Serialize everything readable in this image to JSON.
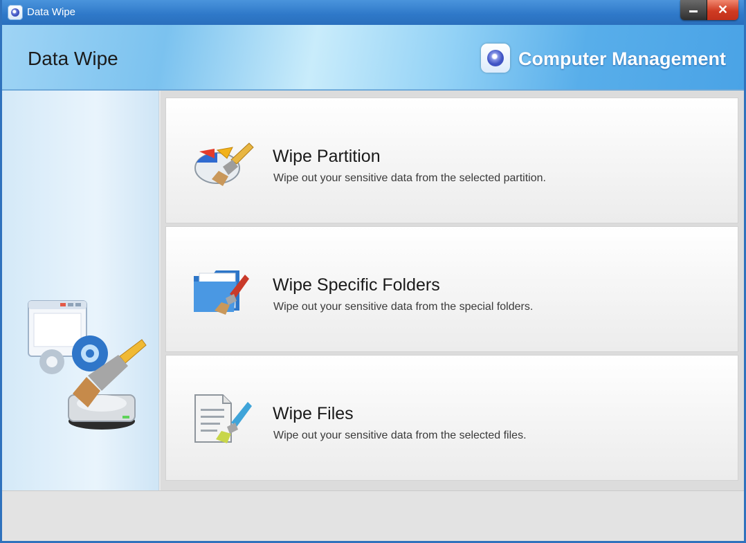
{
  "window": {
    "title": "Data Wipe",
    "close_glyph": "✕"
  },
  "header": {
    "title": "Data Wipe",
    "brand": "Computer Management",
    "brand_icon": "computer-management-logo-icon"
  },
  "options": [
    {
      "title": "Wipe Partition",
      "description": "Wipe out your sensitive data from the selected partition.",
      "icon": "partition-brush-icon"
    },
    {
      "title": "Wipe Specific Folders",
      "description": "Wipe out your sensitive data from the special folders.",
      "icon": "folder-brush-icon"
    },
    {
      "title": "Wipe Files",
      "description": "Wipe out your sensitive data from the selected files.",
      "icon": "files-brush-icon"
    }
  ],
  "sidebar": {
    "illustration": "data-wipe-illustration-icon"
  },
  "colors": {
    "titlebar": "#2e78c8",
    "accent": "#4aa3e6",
    "close_button": "#cf3b22"
  }
}
